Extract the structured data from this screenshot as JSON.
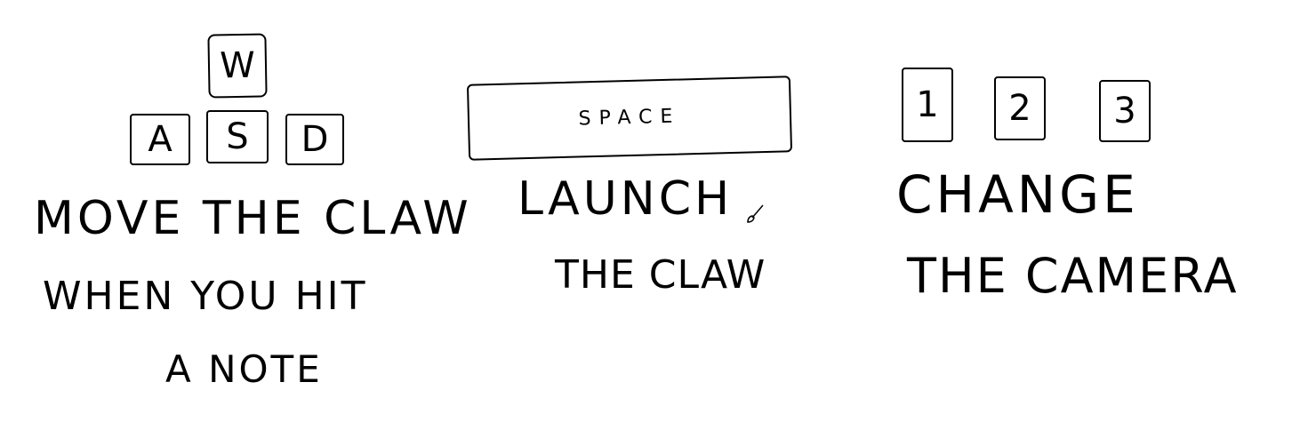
{
  "move_group": {
    "keys": {
      "w": "W",
      "a": "A",
      "s": "S",
      "d": "D"
    },
    "caption_line1": "MOVE THE CLAW",
    "caption_line2": "WHEN YOU HIT",
    "caption_line3": "A NOTE"
  },
  "launch_group": {
    "key_label": "SPACE",
    "caption_line1": "LAUNCH",
    "caption_line2": "THE CLAW",
    "cursor_icon": "paintbrush-icon"
  },
  "camera_group": {
    "keys": [
      "1",
      "2",
      "3"
    ],
    "caption_line1": "CHANGE",
    "caption_line2": "THE CAMERA"
  },
  "colors": {
    "ink": "#000000",
    "background": "#ffffff"
  }
}
